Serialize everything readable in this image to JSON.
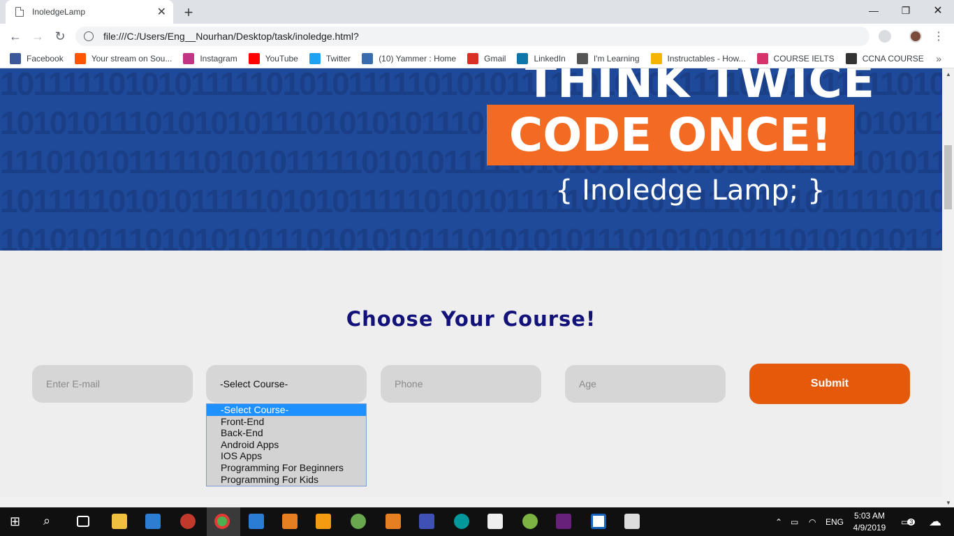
{
  "browser": {
    "tab_title": "InoledgeLamp",
    "url": "file:///C:/Users/Eng__Nourhan/Desktop/task/inoledge.html?",
    "bookmarks": [
      {
        "label": "Facebook",
        "icon": "facebook-icon",
        "color": "#3b5998"
      },
      {
        "label": "Your stream on Sou...",
        "icon": "soundcloud-icon",
        "color": "#ff5500"
      },
      {
        "label": "Instagram",
        "icon": "instagram-icon",
        "color": "#c13584"
      },
      {
        "label": "YouTube",
        "icon": "youtube-icon",
        "color": "#ff0000"
      },
      {
        "label": "Twitter",
        "icon": "twitter-icon",
        "color": "#1da1f2"
      },
      {
        "label": "(10) Yammer : Home",
        "icon": "yammer-icon",
        "color": "#396cab"
      },
      {
        "label": "Gmail",
        "icon": "gmail-icon",
        "color": "#d93025"
      },
      {
        "label": "LinkedIn",
        "icon": "linkedin-icon",
        "color": "#0e76a8"
      },
      {
        "label": "I'm Learning",
        "icon": "learning-icon",
        "color": "#555555"
      },
      {
        "label": "Instructables - How...",
        "icon": "instructables-icon",
        "color": "#f5b400"
      },
      {
        "label": "COURSE IELTS",
        "icon": "edx-icon",
        "color": "#d6336c"
      },
      {
        "label": "CCNA COURSE",
        "icon": "ccna-icon",
        "color": "#333333"
      }
    ]
  },
  "banner": {
    "line1": "THINK TWICE",
    "line2": "CODE ONCE!",
    "tagline": "{ Inoledge Lamp; }",
    "colors": {
      "background": "#1f4a9a",
      "accent": "#f36a22"
    }
  },
  "form": {
    "heading": "Choose Your Course!",
    "email_placeholder": "Enter E-mail",
    "course_selected": "-Select Course-",
    "phone_placeholder": "Phone",
    "age_placeholder": "Age",
    "submit_label": "Submit",
    "course_options": [
      "-Select Course-",
      "Front-End",
      "Back-End",
      "Android Apps",
      "IOS Apps",
      "Programming For Beginners",
      "Programming For Kids"
    ]
  },
  "taskbar": {
    "language": "ENG",
    "time": "5:03 AM",
    "date": "4/9/2019",
    "notification_count": "3"
  }
}
